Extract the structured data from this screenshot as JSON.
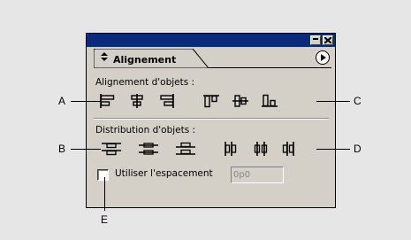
{
  "panel": {
    "tab_label": "Alignement",
    "align_section": "Alignement d'objets :",
    "distribute_section": "Distribution d'objets :",
    "spacing_checkbox_label": "Utiliser l'espacement",
    "spacing_value": "0p0",
    "spacing_checked": false
  },
  "callouts": {
    "a": "A",
    "b": "B",
    "c": "C",
    "d": "D",
    "e": "E"
  },
  "icons": {
    "window_minimize": "minimize-icon",
    "window_close": "close-icon",
    "panel_menu": "panel-menu-arrow-icon",
    "align_row": [
      "align-left-edges-icon",
      "align-horizontal-centers-icon",
      "align-right-edges-icon",
      "align-top-edges-icon",
      "align-vertical-centers-icon",
      "align-bottom-edges-icon"
    ],
    "distribute_row": [
      "distribute-top-edges-icon",
      "distribute-vertical-centers-icon",
      "distribute-bottom-edges-icon",
      "distribute-left-edges-icon",
      "distribute-horizontal-centers-icon",
      "distribute-right-edges-icon"
    ]
  },
  "colors": {
    "titlebar": "#0a2a7a",
    "panel_bg": "#d4d0c8",
    "page_bg": "#e6e6e6"
  }
}
